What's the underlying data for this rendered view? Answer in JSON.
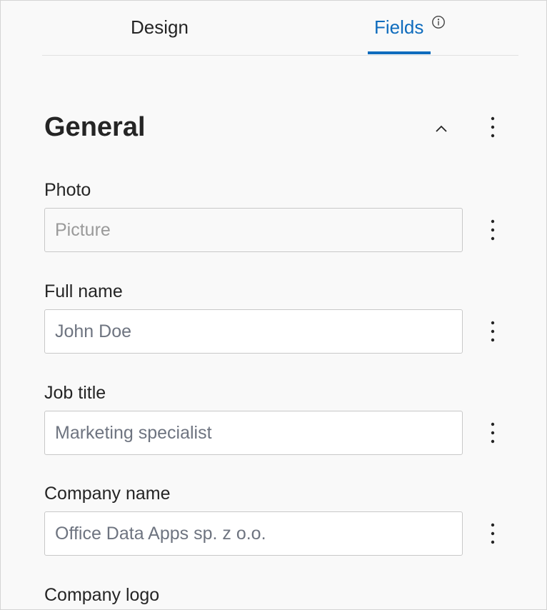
{
  "tabs": {
    "design_label": "Design",
    "fields_label": "Fields",
    "active": "Fields"
  },
  "section": {
    "title": "General"
  },
  "fields": [
    {
      "label": "Photo",
      "placeholder": "Picture"
    },
    {
      "label": "Full name",
      "placeholder": "John Doe"
    },
    {
      "label": "Job title",
      "placeholder": "Marketing specialist"
    },
    {
      "label": "Company name",
      "placeholder": "Office Data Apps sp. z o.o."
    },
    {
      "label": "Company logo"
    }
  ],
  "colors": {
    "accent": "#0f6cbd",
    "background": "#f9f9f9",
    "text": "#252525",
    "placeholder": "#6e7480",
    "border": "#c8c8c8"
  },
  "icons": {
    "info": "info-icon",
    "collapse": "chevron-up-icon",
    "more": "more-options-icon"
  }
}
